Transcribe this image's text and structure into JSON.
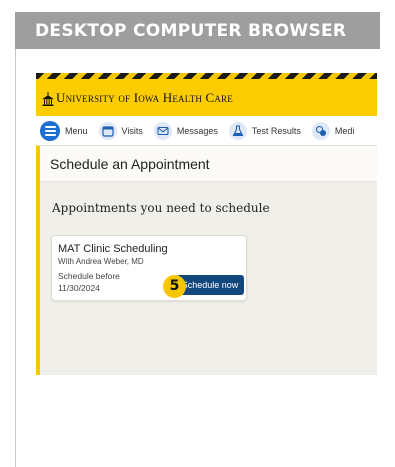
{
  "banner": {
    "title": "DESKTOP COMPUTER BROWSER"
  },
  "header": {
    "logo_text": "University of Iowa Health Care"
  },
  "nav": {
    "items": [
      {
        "label": "Menu",
        "icon": "menu-icon"
      },
      {
        "label": "Visits",
        "icon": "calendar-icon"
      },
      {
        "label": "Messages",
        "icon": "envelope-icon"
      },
      {
        "label": "Test Results",
        "icon": "flask-icon"
      },
      {
        "label": "Medi",
        "icon": "pills-icon"
      }
    ]
  },
  "page": {
    "title": "Schedule an Appointment",
    "section_heading": "Appointments you need to schedule"
  },
  "card": {
    "title": "MAT Clinic Scheduling",
    "subtitle": "With Andrea Weber, MD",
    "before_label": "Schedule before",
    "date": "11/30/2024",
    "button_label": "Schedule now",
    "step_number": "5"
  },
  "colors": {
    "brand_yellow": "#fbcd00",
    "button_blue": "#12487e",
    "menu_blue": "#1c6fd1",
    "banner_gray": "#9e9e9e"
  }
}
